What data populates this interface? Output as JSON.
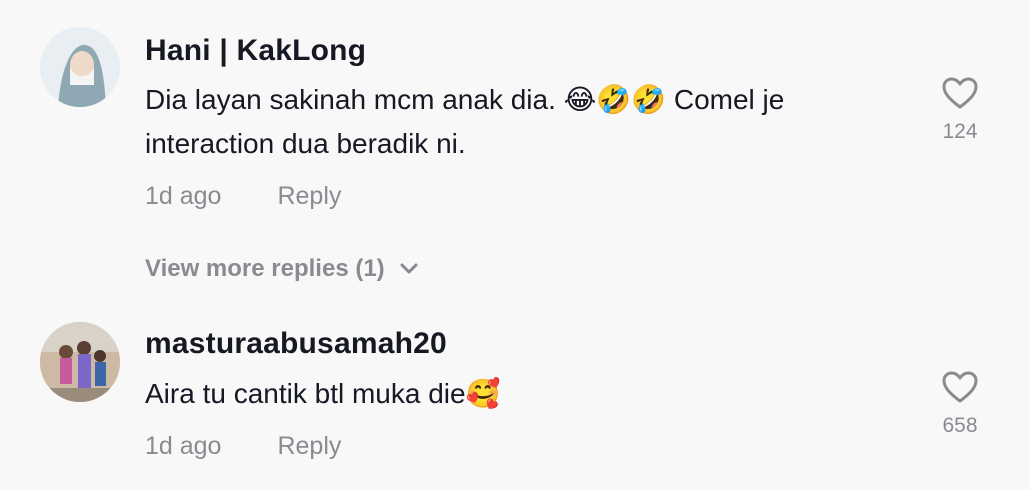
{
  "comments": [
    {
      "username": "Hani | KakLong",
      "text": "Dia layan sakinah mcm anak dia. 😂🤣🤣 Comel je interaction dua beradik ni.",
      "time": "1d ago",
      "reply_label": "Reply",
      "likes": "124",
      "more_replies": "View more replies (1)"
    },
    {
      "username": "masturaabusamah20",
      "text": "Aira tu cantik btl muka die🥰",
      "time": "1d ago",
      "reply_label": "Reply",
      "likes": "658"
    }
  ],
  "icons": {
    "like": "heart-outline-icon",
    "expand": "chevron-down-icon"
  },
  "colors": {
    "background": "#f8f8f8",
    "primary_text": "#161823",
    "secondary_text": "#8a8b91"
  }
}
